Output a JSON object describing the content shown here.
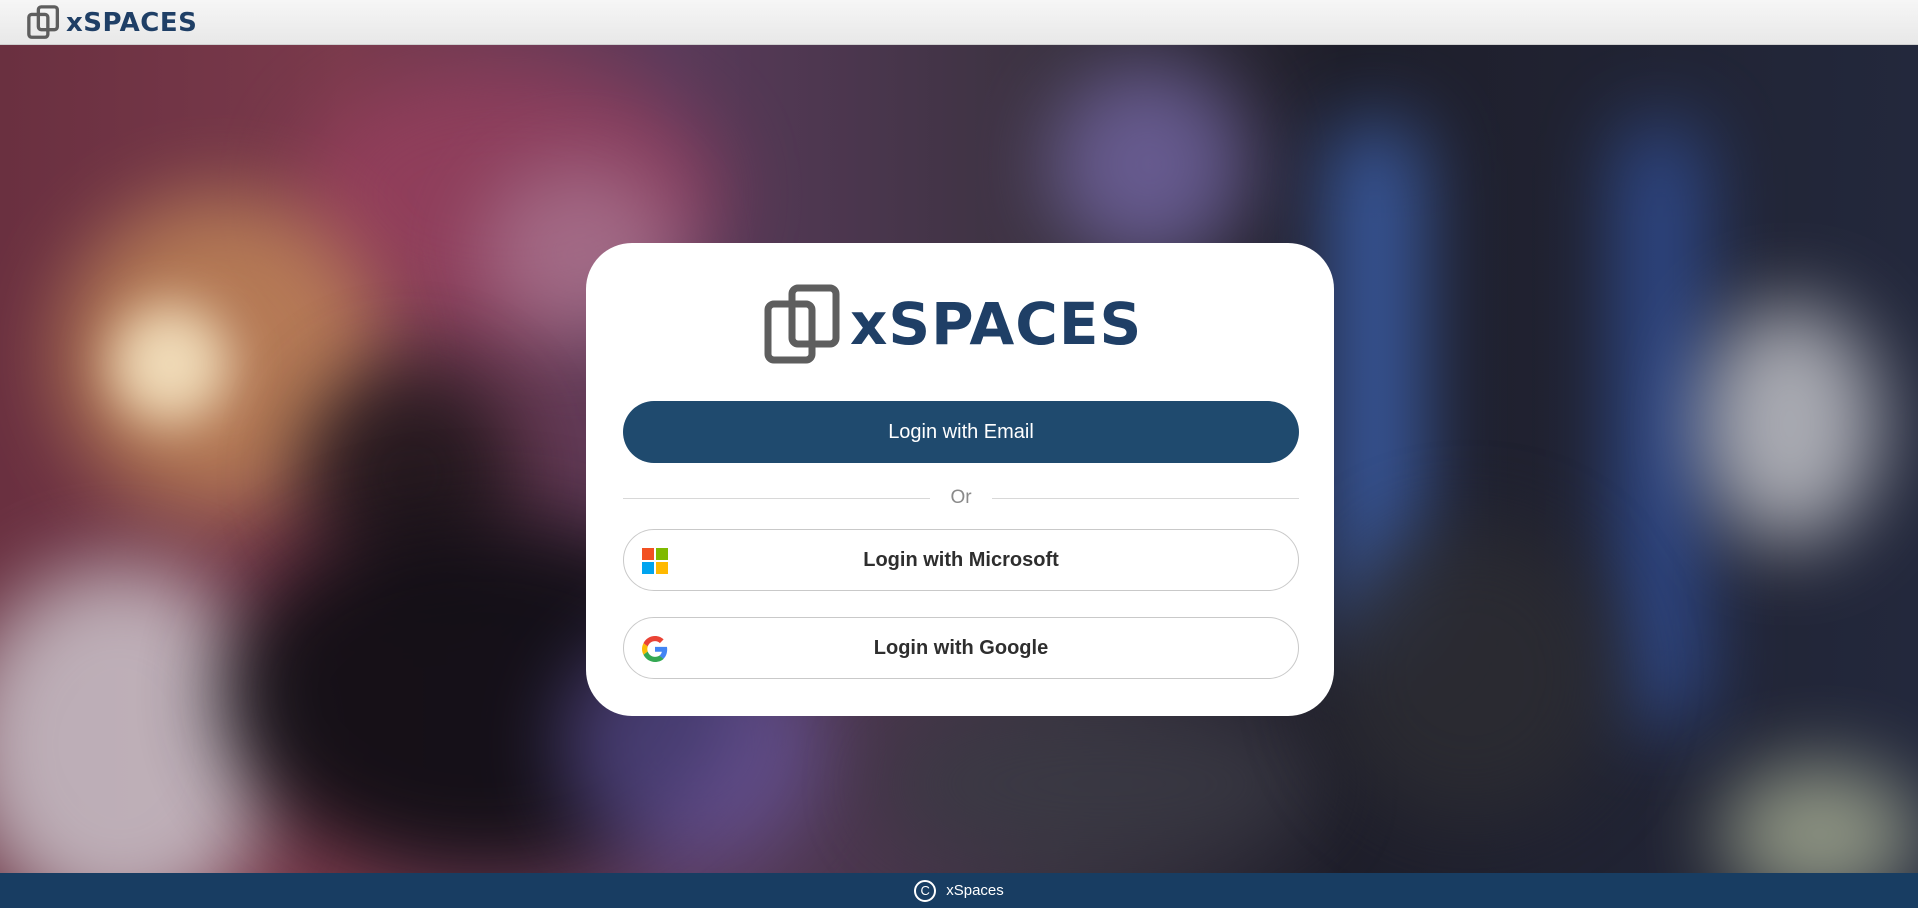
{
  "header": {
    "logo_text": "xSPACES",
    "logo_icon": "xspaces-logo-icon"
  },
  "login_card": {
    "logo_text": "xSPACES",
    "logo_icon": "xspaces-logo-icon",
    "email_button_label": "Login with Email",
    "divider_text": "Or",
    "microsoft_button_label": "Login with Microsoft",
    "microsoft_icon": "microsoft-icon",
    "google_button_label": "Login with Google",
    "google_icon": "google-icon"
  },
  "footer": {
    "copyright_icon": "copyright-icon",
    "copyright_symbol": "C",
    "text": "xSpaces"
  },
  "colors": {
    "brand_navy": "#1f4a6e",
    "footer_bg": "#183d62",
    "logo_text": "#1f3f66",
    "logo_mark": "#5e5e5e"
  }
}
